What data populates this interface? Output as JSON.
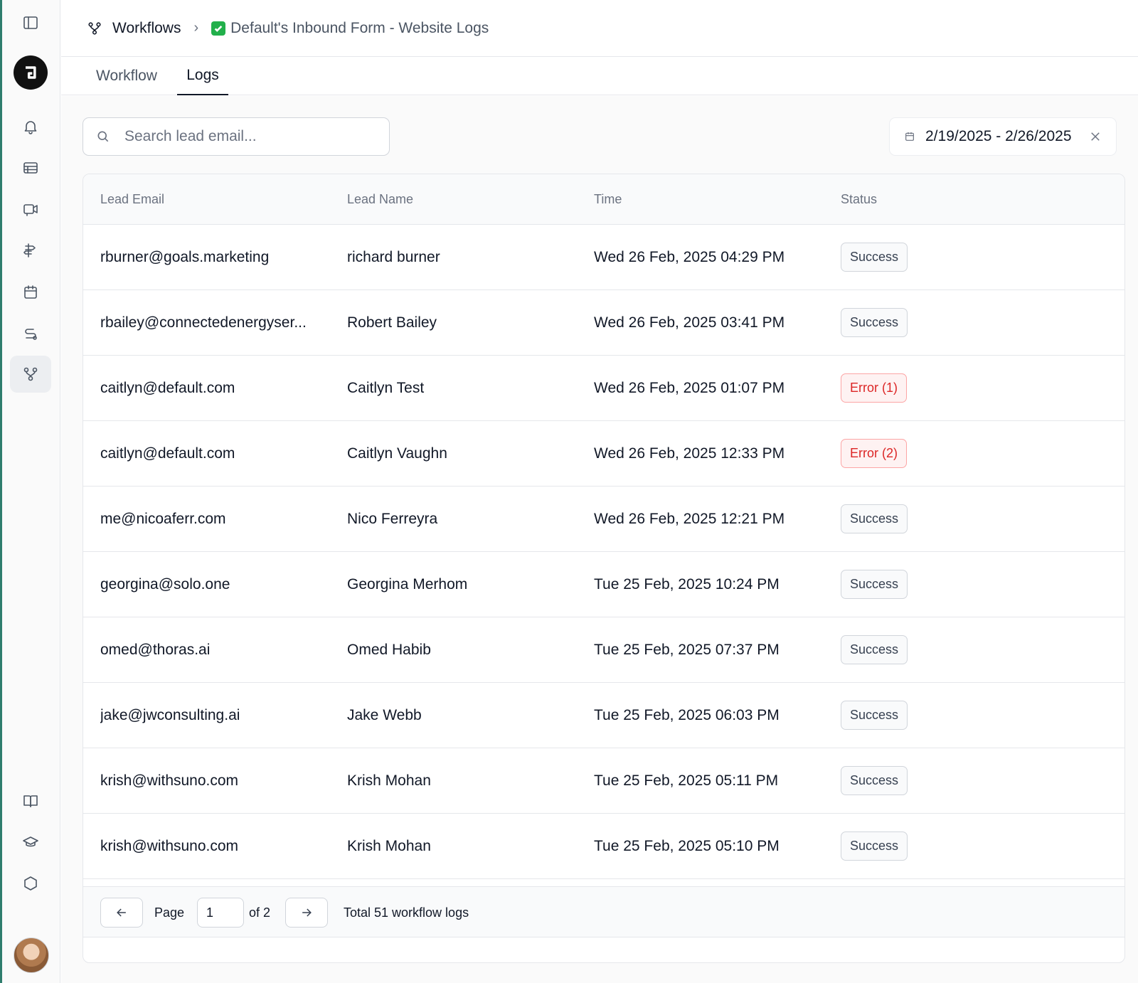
{
  "breadcrumb": {
    "root": "Workflows",
    "current": "Default's Inbound Form - Website Logs"
  },
  "tabs": [
    {
      "label": "Workflow",
      "active": false
    },
    {
      "label": "Logs",
      "active": true
    }
  ],
  "search": {
    "placeholder": "Search lead email...",
    "value": ""
  },
  "date_range": {
    "label": "2/19/2025 - 2/26/2025"
  },
  "table": {
    "headers": [
      "Lead Email",
      "Lead Name",
      "Time",
      "Status"
    ],
    "rows": [
      {
        "email": "rburner@goals.marketing",
        "name": "richard burner",
        "time": "Wed 26 Feb, 2025 04:29 PM",
        "status": "Success",
        "status_type": "success"
      },
      {
        "email": "rbailey@connectedenergyser...",
        "name": "Robert Bailey",
        "time": "Wed 26 Feb, 2025 03:41 PM",
        "status": "Success",
        "status_type": "success"
      },
      {
        "email": "caitlyn@default.com",
        "name": "Caitlyn Test",
        "time": "Wed 26 Feb, 2025 01:07 PM",
        "status": "Error (1)",
        "status_type": "error"
      },
      {
        "email": "caitlyn@default.com",
        "name": "Caitlyn Vaughn",
        "time": "Wed 26 Feb, 2025 12:33 PM",
        "status": "Error (2)",
        "status_type": "error"
      },
      {
        "email": "me@nicoaferr.com",
        "name": "Nico Ferreyra",
        "time": "Wed 26 Feb, 2025 12:21 PM",
        "status": "Success",
        "status_type": "success"
      },
      {
        "email": "georgina@solo.one",
        "name": "Georgina Merhom",
        "time": "Tue 25 Feb, 2025 10:24 PM",
        "status": "Success",
        "status_type": "success"
      },
      {
        "email": "omed@thoras.ai",
        "name": "Omed Habib",
        "time": "Tue 25 Feb, 2025 07:37 PM",
        "status": "Success",
        "status_type": "success"
      },
      {
        "email": "jake@jwconsulting.ai",
        "name": "Jake Webb",
        "time": "Tue 25 Feb, 2025 06:03 PM",
        "status": "Success",
        "status_type": "success"
      },
      {
        "email": "krish@withsuno.com",
        "name": "Krish Mohan",
        "time": "Tue 25 Feb, 2025 05:11 PM",
        "status": "Success",
        "status_type": "success"
      },
      {
        "email": "krish@withsuno.com",
        "name": "Krish Mohan",
        "time": "Tue 25 Feb, 2025 05:10 PM",
        "status": "Success",
        "status_type": "success"
      }
    ]
  },
  "pagination": {
    "page_label": "Page",
    "current_page": "1",
    "of_label": "of 2",
    "total_label": "Total 51 workflow logs"
  },
  "colors": {
    "accent": "#2f7d6d",
    "error": "#dc2626",
    "check": "#22b04b"
  },
  "icons": {
    "sidebar": [
      "sidebar-toggle-icon",
      "bell-icon",
      "table-icon",
      "video-icon",
      "signpost-icon",
      "calendar-icon",
      "route-icon",
      "workflow-icon",
      "book-icon",
      "graduation-cap-icon",
      "hexagon-icon"
    ]
  }
}
